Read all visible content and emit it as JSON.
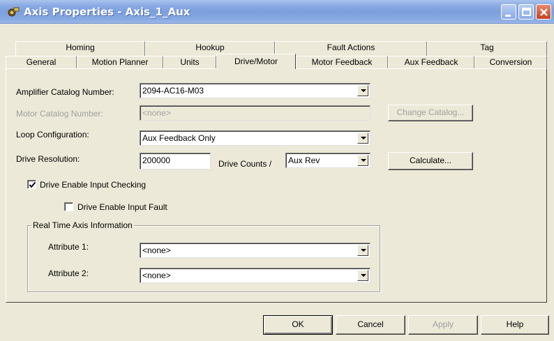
{
  "window": {
    "title": "Axis Properties - Axis_1_Aux"
  },
  "tabs": {
    "back_row": [
      "Homing",
      "Hookup",
      "Fault Actions",
      "Tag"
    ],
    "front_row": [
      "General",
      "Motion Planner",
      "Units",
      "Drive/Motor",
      "Motor Feedback",
      "Aux Feedback",
      "Conversion"
    ],
    "active": "Drive/Motor"
  },
  "form": {
    "amplifier_label": "Amplifier Catalog Number:",
    "amplifier_value": "2094-AC16-M03",
    "motor_label": "Motor Catalog Number:",
    "motor_value": "<none>",
    "change_catalog_label": "Change Catalog...",
    "loop_label": "Loop Configuration:",
    "loop_value": "Aux Feedback Only",
    "resolution_label": "Drive Resolution:",
    "resolution_value": "200000",
    "drive_counts_label": "Drive Counts /",
    "per_unit_value": "Aux Rev",
    "calculate_label": "Calculate...",
    "enable_input_checking_label": "Drive Enable Input Checking",
    "enable_input_checking_checked": true,
    "enable_input_fault_label": "Drive Enable Input Fault",
    "enable_input_fault_checked": false
  },
  "realtime": {
    "group_label": "Real Time Axis Information",
    "attr1_label": "Attribute 1:",
    "attr1_value": "<none>",
    "attr2_label": "Attribute 2:",
    "attr2_value": "<none>"
  },
  "footer": {
    "ok": "OK",
    "cancel": "Cancel",
    "apply": "Apply",
    "help": "Help"
  },
  "icons": [
    "axis-app-icon",
    "minimize-icon",
    "maximize-icon",
    "close-icon",
    "dropdown-arrow-icon",
    "checkmark-icon"
  ]
}
